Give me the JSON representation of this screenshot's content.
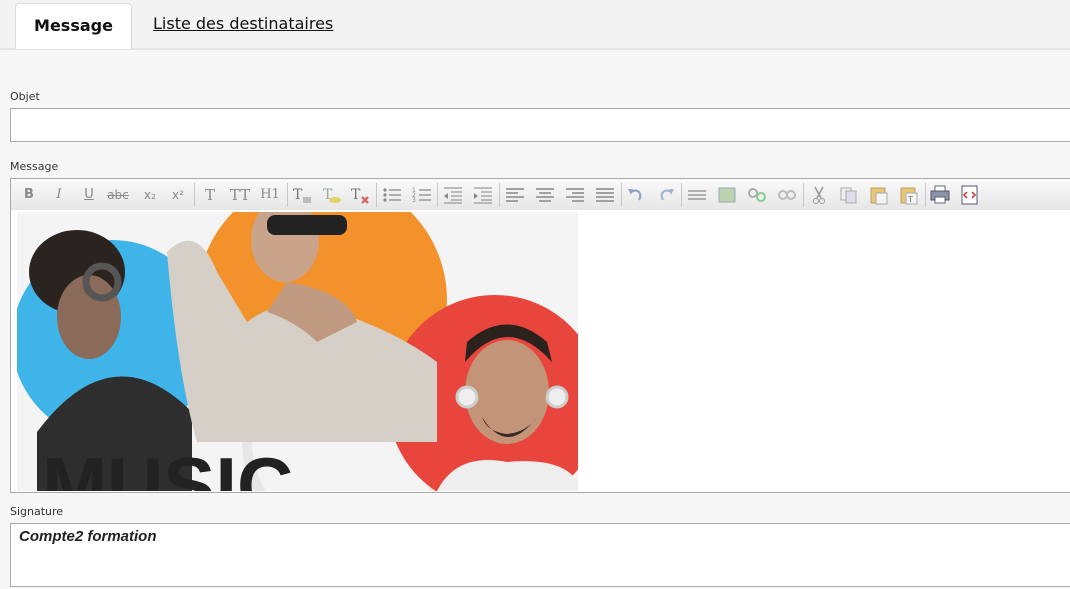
{
  "tabs": {
    "message": "Message",
    "recipients": "Liste des destinataires"
  },
  "subject": {
    "label": "Objet",
    "value": ""
  },
  "message": {
    "label": "Message",
    "banner_text": "MUSIC"
  },
  "signature": {
    "label": "Signature",
    "text": "Compte2 formation"
  },
  "toolbar": {
    "bold": "B",
    "italic": "I",
    "underline": "U",
    "strike": "abc",
    "subscript": "x₂",
    "superscript": "x²",
    "font_size": "T",
    "font_family": "TT",
    "heading": "H1"
  },
  "colors": {
    "orange": "#f3922a",
    "blue": "#3fb4e8",
    "red": "#e8453c"
  }
}
